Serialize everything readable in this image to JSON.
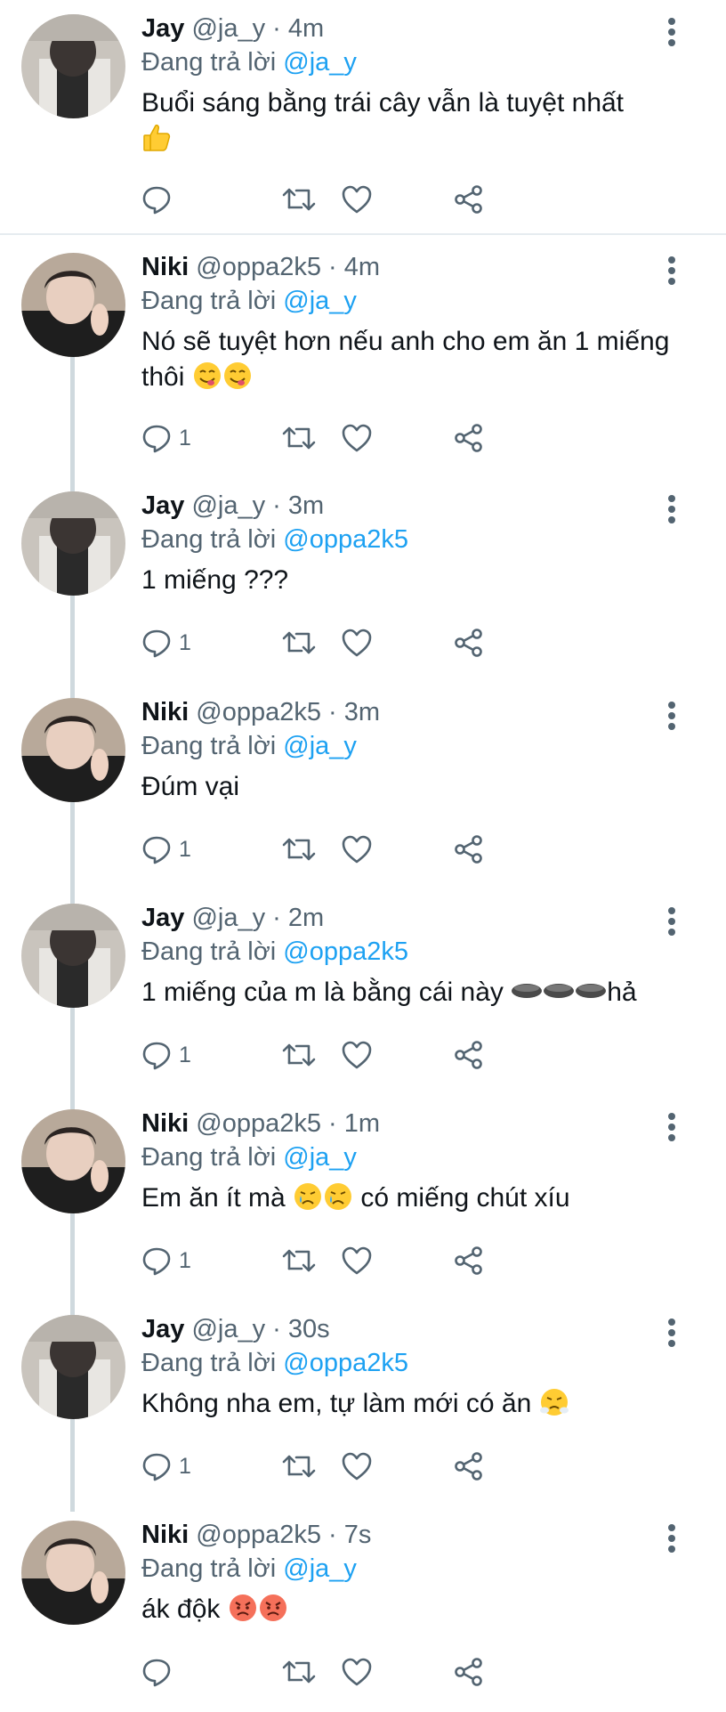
{
  "reply_prefix": "Đang trả lời",
  "tweets": [
    {
      "name": "Jay",
      "handle": "@ja_y",
      "time": "4m",
      "reply_to": "@ja_y",
      "text": "Buổi sáng bằng trái cây vẫn là tuyệt nhất",
      "reply_count": "",
      "emojis": [
        "thumbs-up"
      ]
    },
    {
      "name": "Niki",
      "handle": "@oppa2k5",
      "time": "4m",
      "reply_to": "@ja_y",
      "text": "Nó sẽ tuyệt hơn nếu anh cho em ăn 1 miếng thôi",
      "reply_count": "1",
      "emojis": [
        "yum",
        "yum"
      ]
    },
    {
      "name": "Jay",
      "handle": "@ja_y",
      "time": "3m",
      "reply_to": "@oppa2k5",
      "text": "1 miếng ???",
      "reply_count": "1",
      "emojis": []
    },
    {
      "name": "Niki",
      "handle": "@oppa2k5",
      "time": "3m",
      "reply_to": "@ja_y",
      "text": "Đúm vại",
      "reply_count": "1",
      "emojis": []
    },
    {
      "name": "Jay",
      "handle": "@ja_y",
      "time": "2m",
      "reply_to": "@oppa2k5",
      "text": "1 miếng của m là bằng cái này",
      "text_suffix": "hả",
      "reply_count": "1",
      "emojis": [
        "black-circle",
        "black-circle",
        "black-circle"
      ]
    },
    {
      "name": "Niki",
      "handle": "@oppa2k5",
      "time": "1m",
      "reply_to": "@ja_y",
      "text": "Em ăn ít mà",
      "text_suffix": "có miếng chút xíu",
      "reply_count": "1",
      "emojis": [
        "crying",
        "crying"
      ]
    },
    {
      "name": "Jay",
      "handle": "@ja_y",
      "time": "30s",
      "reply_to": "@oppa2k5",
      "text": "Không nha em, tự làm mới có ăn",
      "reply_count": "1",
      "emojis": [
        "triumph"
      ]
    },
    {
      "name": "Niki",
      "handle": "@oppa2k5",
      "time": "7s",
      "reply_to": "@ja_y",
      "text": "ák độk",
      "reply_count": "",
      "emojis": [
        "angry",
        "angry"
      ]
    }
  ],
  "colors": {
    "link": "#1da1f2",
    "secondary": "#536471",
    "divider": "#e6ecf0",
    "thread": "#cfd9de"
  },
  "icons": [
    "more-vertical-icon",
    "reply-icon",
    "retweet-icon",
    "like-icon",
    "share-icon"
  ]
}
